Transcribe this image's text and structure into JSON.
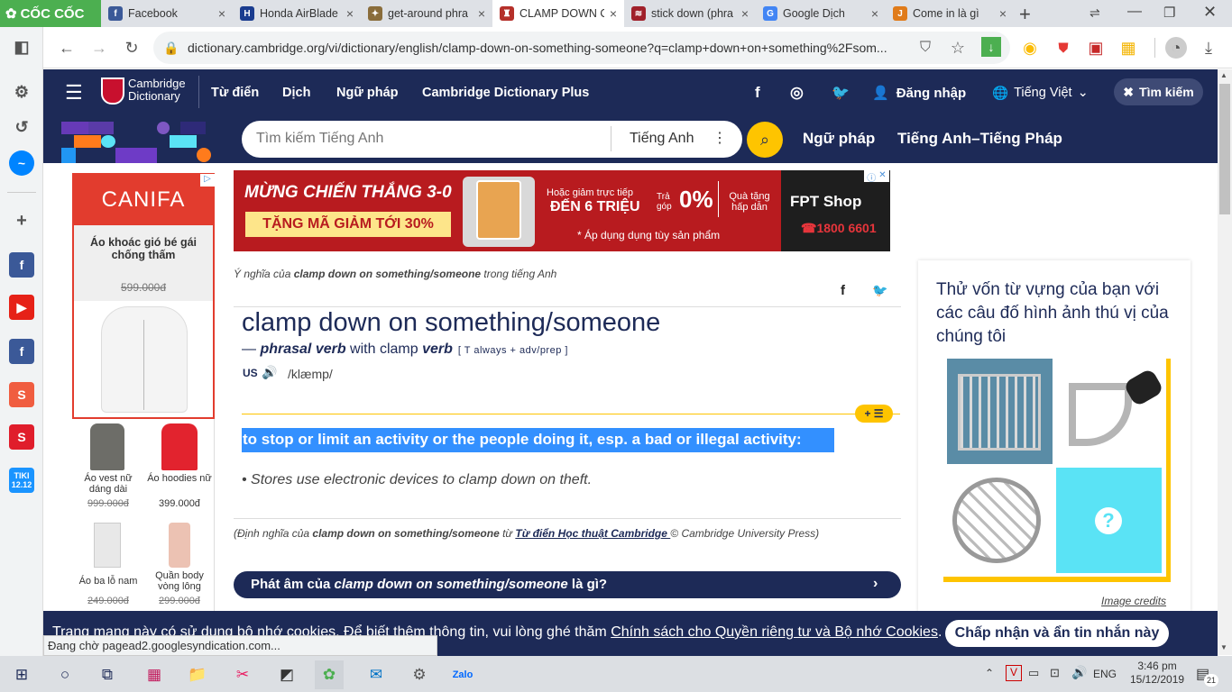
{
  "browser": {
    "brand": "CỐC CỐC",
    "tabs": [
      {
        "title": "Facebook",
        "icon": "facebook-icon"
      },
      {
        "title": "Honda AirBlade",
        "icon": "honda-icon"
      },
      {
        "title": "get-around phra",
        "icon": "puzzle-icon"
      },
      {
        "title": "CLAMP DOWN O",
        "icon": "cambridge-icon"
      },
      {
        "title": "stick down (phra",
        "icon": "book-icon"
      },
      {
        "title": "Google Dịch",
        "icon": "translate-icon"
      },
      {
        "title": "Come in là gì",
        "icon": "j-icon"
      }
    ],
    "tab_close": "×",
    "new_tab": "+",
    "url": "dictionary.cambridge.org/vi/dictionary/english/clamp-down-on-something-someone?q=clamp+down+on+something%2Fsom..."
  },
  "site": {
    "logo_line1": "Cambridge",
    "logo_line2": "Dictionary",
    "nav": [
      "Từ điển",
      "Dịch",
      "Ngữ pháp",
      "Cambridge Dictionary Plus"
    ],
    "login": "Đăng nhập",
    "language": "Tiếng Việt",
    "search_button": "Tìm kiếm",
    "search_placeholder": "Tìm kiếm Tiếng Anh",
    "search_lang": "Tiếng Anh",
    "sub_nav": [
      "Ngữ pháp",
      "Tiếng Anh–Tiếng Pháp"
    ]
  },
  "ad_left": {
    "brand": "CANIFA",
    "product": "Áo khoác gió bé gái chống thấm",
    "price": "599.000đ",
    "items": [
      {
        "name": "Áo vest nữ dáng dài",
        "price": "999.000đ",
        "strike": true
      },
      {
        "name": "Áo hoodies nữ",
        "price": "399.000đ",
        "strike": false
      },
      {
        "name": "Áo ba lỗ nam",
        "price": "249.000đ",
        "strike": true
      },
      {
        "name": "Quần body vòng lông",
        "price": "299.000đ",
        "strike": true
      }
    ]
  },
  "ad_banner": {
    "headline": "MỪNG CHIẾN THẮNG 3-0",
    "coupon": "TẶNG MÃ GIẢM TỚI 30%",
    "offer_small": "Hoặc giảm trực tiếp",
    "offer_big": "ĐẾN 6 TRIỆU",
    "installment_label": "Trả góp",
    "installment_value": "0%",
    "gift": "Quà tặng hấp dẫn",
    "note": "* Áp dụng dụng tùy sản phẩm",
    "shop": "FPT Shop",
    "phone": "1800 6601"
  },
  "entry": {
    "meaning_prefix": "Ý nghĩa của ",
    "meaning_term": "clamp down on something/someone",
    "meaning_suffix": " trong tiếng Anh",
    "headword": "clamp down on something/someone",
    "dash": "— ",
    "pos": "phrasal verb",
    "with": " with clamp ",
    "pos2": "verb",
    "grammar": "[ T always + adv/prep ]",
    "region": "US",
    "ipa": "/klæmp/",
    "definition": "to stop or limit an activity or the people doing it, esp. a bad or illegal activity:",
    "example": "Stores use electronic devices to clamp down on theft.",
    "source_prefix": "(Định nghĩa của ",
    "source_term": "clamp down on something/someone",
    "source_mid": " từ ",
    "source_link": "Từ điển Học thuật Cambridge ",
    "source_suffix": " © Cambridge University Press)",
    "pron_prefix": "Phát âm của ",
    "pron_term": "clamp down on something/someone",
    "pron_suffix": " là gì?",
    "add_list": "+ ☰"
  },
  "quiz": {
    "title": "Thử vốn từ vựng của bạn với các câu đố hình ảnh thú vị của chúng tôi",
    "credits": "Image credits",
    "question_mark": "?"
  },
  "cookie": {
    "text": "Trang mạng này có sử dụng bộ nhớ cookies. Để biết thêm thông tin, vui lòng ghé thăm ",
    "link": "Chính sách cho Quyền riêng tư và Bộ nhớ Cookies",
    "end": ".",
    "accept": "Chấp nhận và ẩn tin nhắn này"
  },
  "status": "Đang chờ pagead2.googlesyndication.com...",
  "taskbar": {
    "lang": "ENG",
    "time": "3:46 pm",
    "date": "15/12/2019",
    "notifications": "21"
  }
}
